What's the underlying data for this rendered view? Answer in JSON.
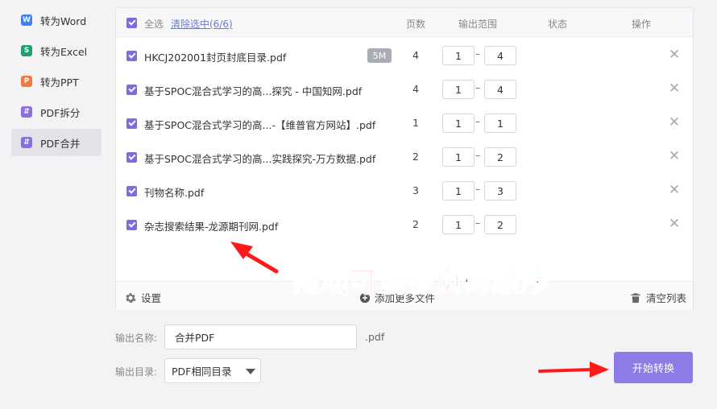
{
  "sidebar": {
    "items": [
      {
        "label": "转为Word",
        "icon": "word-icon",
        "icon_char": "W",
        "color": "#3b82f6",
        "active": false
      },
      {
        "label": "转为Excel",
        "icon": "excel-icon",
        "icon_char": "S",
        "color": "#22a06b",
        "active": false
      },
      {
        "label": "转为PPT",
        "icon": "ppt-icon",
        "icon_char": "P",
        "color": "#f07b3f",
        "active": false
      },
      {
        "label": "PDF拆分",
        "icon": "split-icon",
        "icon_char": "⇵",
        "color": "#8b6fe0",
        "active": false
      },
      {
        "label": "PDF合并",
        "icon": "merge-icon",
        "icon_char": "⇵",
        "color": "#8b6fe0",
        "active": true
      }
    ]
  },
  "header": {
    "select_all": "全选",
    "clear_selected": "清除选中(6/6)",
    "col_pages": "页数",
    "col_range": "输出范围",
    "col_status": "状态",
    "col_action": "操作"
  },
  "files": [
    {
      "name": "HKCJ202001封页封底目录.pdf",
      "size": "5M",
      "pages": "4",
      "from": "1",
      "to": "4"
    },
    {
      "name": "基于SPOC混合式学习的高...探究 - 中国知网.pdf",
      "size": "",
      "pages": "4",
      "from": "1",
      "to": "4"
    },
    {
      "name": "基于SPOC混合式学习的高...-【维普官方网站】.pdf",
      "size": "",
      "pages": "1",
      "from": "1",
      "to": "1"
    },
    {
      "name": "基于SPOC混合式学习的高...实践探究-万方数据.pdf",
      "size": "",
      "pages": "2",
      "from": "1",
      "to": "2"
    },
    {
      "name": "刊物名称.pdf",
      "size": "",
      "pages": "3",
      "from": "1",
      "to": "3"
    },
    {
      "name": "杂志搜索结果-龙源期刊网.pdf",
      "size": "",
      "pages": "2",
      "from": "1",
      "to": "2"
    }
  ],
  "range_separator": "–",
  "footer": {
    "settings": "设置",
    "add_more": "添加更多文件",
    "clear_list": "清空列表"
  },
  "output": {
    "name_label": "输出名称:",
    "name_value": "合并PDF",
    "extension": ".pdf",
    "dir_label": "输出目录:",
    "dir_value": "PDF相同目录"
  },
  "start_button": "开始转换",
  "annotation_text": "拖动可调整页码顺序",
  "colors": {
    "accent": "#8d7be8",
    "checkbox": "#7e6be0",
    "link": "#6b7dc9",
    "annotation": "#ff1a1a"
  }
}
